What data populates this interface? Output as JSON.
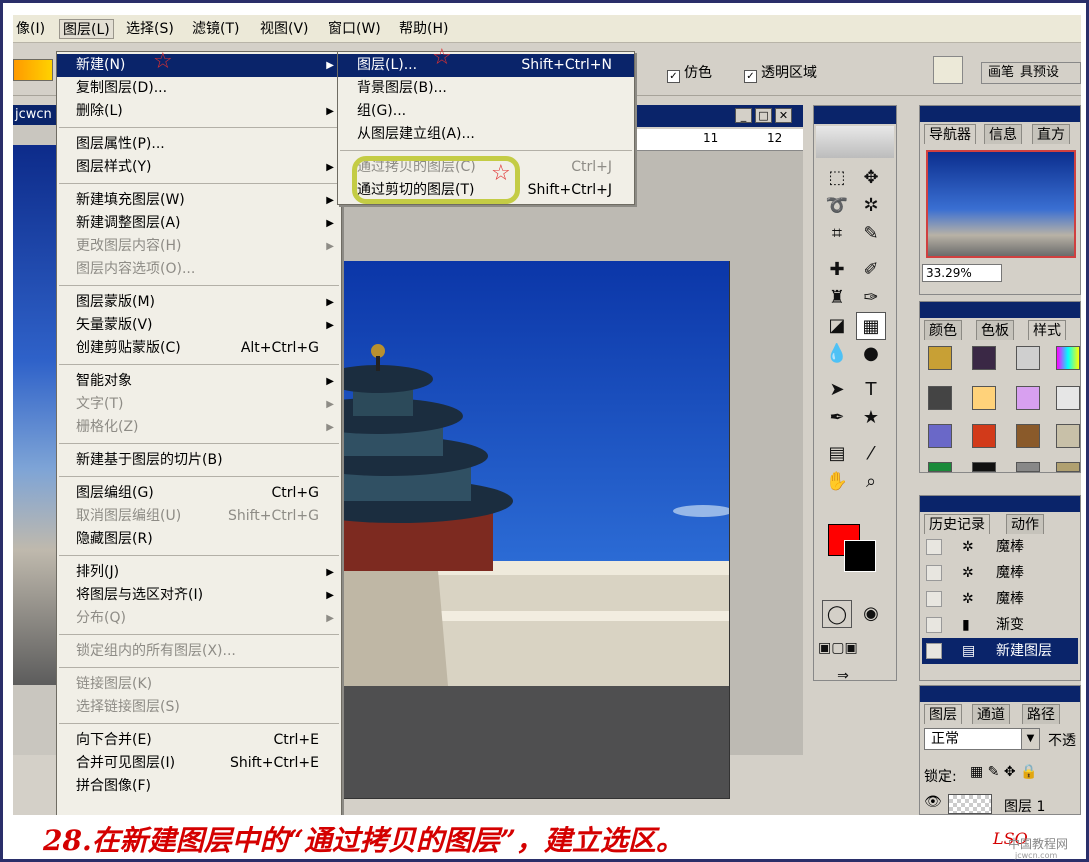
{
  "menubar": {
    "items": [
      "像(I)",
      "图层(L)",
      "选择(S)",
      "滤镜(T)",
      "视图(V)",
      "窗口(W)",
      "帮助(H)"
    ]
  },
  "options": {
    "dither_label": "仿色",
    "transparency_label": "透明区域",
    "brush_tab": "画笔",
    "tool_preset_tab": "具预设"
  },
  "doc_left_title": "jcwcn",
  "ruler_ticks": [
    "11",
    "12"
  ],
  "layer_menu": [
    {
      "label": "新建(N)",
      "arrow": true,
      "highlight": true
    },
    {
      "label": "复制图层(D)..."
    },
    {
      "label": "删除(L)",
      "arrow": true
    },
    {
      "sep": true
    },
    {
      "label": "图层属性(P)..."
    },
    {
      "label": "图层样式(Y)",
      "arrow": true
    },
    {
      "sep": true
    },
    {
      "label": "新建填充图层(W)",
      "arrow": true
    },
    {
      "label": "新建调整图层(A)",
      "arrow": true
    },
    {
      "label": "更改图层内容(H)",
      "arrow": true,
      "disabled": true
    },
    {
      "label": "图层内容选项(O)...",
      "disabled": true
    },
    {
      "sep": true
    },
    {
      "label": "图层蒙版(M)",
      "arrow": true
    },
    {
      "label": "矢量蒙版(V)",
      "arrow": true
    },
    {
      "label": "创建剪贴蒙版(C)",
      "shortcut": "Alt+Ctrl+G"
    },
    {
      "sep": true
    },
    {
      "label": "智能对象",
      "arrow": true
    },
    {
      "label": "文字(T)",
      "arrow": true,
      "disabled": true
    },
    {
      "label": "栅格化(Z)",
      "arrow": true,
      "disabled": true
    },
    {
      "sep": true
    },
    {
      "label": "新建基于图层的切片(B)"
    },
    {
      "sep": true
    },
    {
      "label": "图层编组(G)",
      "shortcut": "Ctrl+G"
    },
    {
      "label": "取消图层编组(U)",
      "shortcut": "Shift+Ctrl+G",
      "disabled": true
    },
    {
      "label": "隐藏图层(R)"
    },
    {
      "sep": true
    },
    {
      "label": "排列(J)",
      "arrow": true
    },
    {
      "label": "将图层与选区对齐(I)",
      "arrow": true
    },
    {
      "label": "分布(Q)",
      "arrow": true,
      "disabled": true
    },
    {
      "sep": true
    },
    {
      "label": "锁定组内的所有图层(X)...",
      "disabled": true
    },
    {
      "sep": true
    },
    {
      "label": "链接图层(K)",
      "disabled": true
    },
    {
      "label": "选择链接图层(S)",
      "disabled": true
    },
    {
      "sep": true
    },
    {
      "label": "向下合并(E)",
      "shortcut": "Ctrl+E"
    },
    {
      "label": "合并可见图层(I)",
      "shortcut": "Shift+Ctrl+E"
    },
    {
      "label": "拼合图像(F)"
    }
  ],
  "new_submenu": [
    {
      "label": "图层(L)...",
      "shortcut": "Shift+Ctrl+N",
      "highlight": true
    },
    {
      "label": "背景图层(B)..."
    },
    {
      "label": "组(G)..."
    },
    {
      "label": "从图层建立组(A)..."
    },
    {
      "sep": true
    },
    {
      "label": "通过拷贝的图层(C)",
      "shortcut": "Ctrl+J",
      "disabled": true
    },
    {
      "label": "通过剪切的图层(T)",
      "shortcut": "Shift+Ctrl+J"
    }
  ],
  "navigator": {
    "tabs": [
      "导航器",
      "信息",
      "直方"
    ],
    "zoom": "33.29%"
  },
  "styles_panel": {
    "tabs": [
      "颜色",
      "色板",
      "样式"
    ]
  },
  "history": {
    "tabs": [
      "历史记录",
      "动作"
    ],
    "items": [
      {
        "label": "魔棒",
        "icon": "magic-wand-icon"
      },
      {
        "label": "魔棒",
        "icon": "magic-wand-icon"
      },
      {
        "label": "魔棒",
        "icon": "magic-wand-icon"
      },
      {
        "label": "渐变",
        "icon": "gradient-icon"
      },
      {
        "label": "新建图层",
        "icon": "layer-icon",
        "selected": true
      }
    ]
  },
  "layers_panel": {
    "tabs": [
      "图层",
      "通道",
      "路径"
    ],
    "blend_mode": "正常",
    "opacity_label": "不透",
    "lock_label": "锁定:",
    "layer_name": "图层 1"
  },
  "colors": {
    "foreground": "#ff0000",
    "background": "#000000",
    "highlight": "#0a246a"
  },
  "caption": "28.在新建图层中的“通过拷贝的图层”，建立选区。",
  "signature": "LSO",
  "watermark": "中国教程网",
  "watermark_url": "jcwcn.com"
}
